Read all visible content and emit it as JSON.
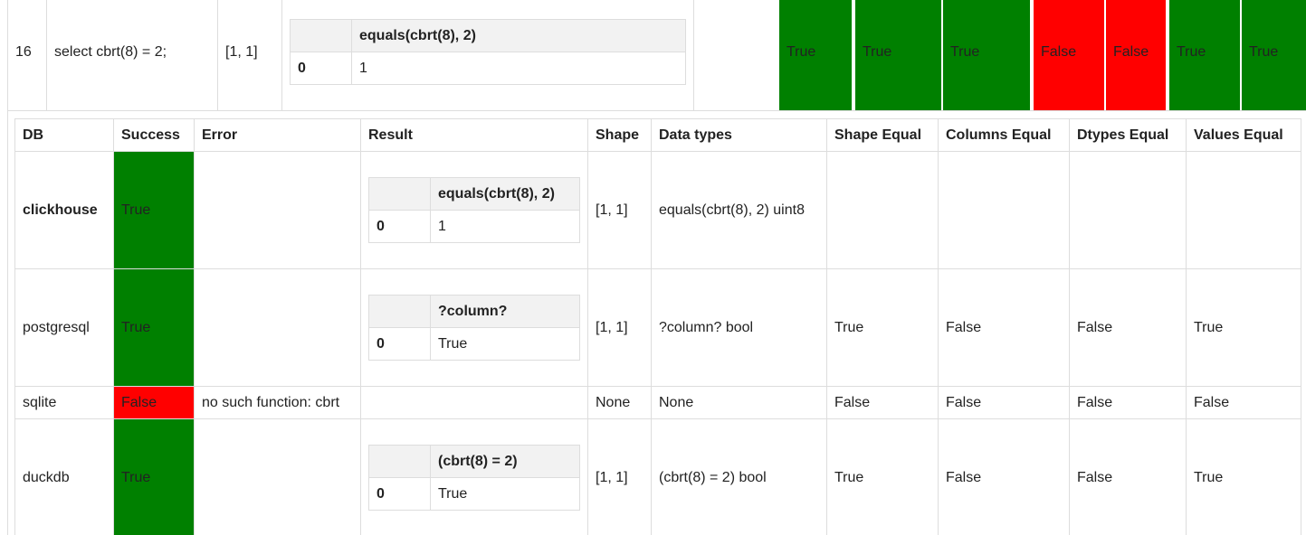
{
  "summary": {
    "row_number": "16",
    "query": "select cbrt(8) = 2;",
    "shape": "[1, 1]",
    "result_table": {
      "column": "equals(cbrt(8), 2)",
      "index": "0",
      "value": "1"
    },
    "flags": [
      {
        "label": "True",
        "status": "green"
      },
      {
        "label": "True",
        "status": "green"
      },
      {
        "label": "True",
        "status": "green"
      },
      {
        "label": "False",
        "status": "red"
      },
      {
        "label": "False",
        "status": "red"
      },
      {
        "label": "True",
        "status": "green"
      },
      {
        "label": "True",
        "status": "green"
      }
    ]
  },
  "comparison": {
    "headers": [
      "DB",
      "Success",
      "Error",
      "Result",
      "Shape",
      "Data types",
      "Shape Equal",
      "Columns Equal",
      "Dtypes Equal",
      "Values Equal"
    ],
    "rows": [
      {
        "db": "clickhouse",
        "success": "True",
        "error": "",
        "result": {
          "column": "equals(cbrt(8), 2)",
          "index": "0",
          "value": "1"
        },
        "shape": "[1, 1]",
        "dtypes": "equals(cbrt(8), 2) uint8",
        "shape_equal": "",
        "columns_equal": "",
        "dtypes_equal": "",
        "values_equal": ""
      },
      {
        "db": "postgresql",
        "success": "True",
        "error": "",
        "result": {
          "column": "?column?",
          "index": "0",
          "value": "True"
        },
        "shape": "[1, 1]",
        "dtypes": "?column? bool",
        "shape_equal": "True",
        "columns_equal": "False",
        "dtypes_equal": "False",
        "values_equal": "True"
      },
      {
        "db": "sqlite",
        "success": "False",
        "error": "no such function: cbrt",
        "result": null,
        "shape": "None",
        "dtypes": "None",
        "shape_equal": "False",
        "columns_equal": "False",
        "dtypes_equal": "False",
        "values_equal": "False"
      },
      {
        "db": "duckdb",
        "success": "True",
        "error": "",
        "result": {
          "column": "(cbrt(8) = 2)",
          "index": "0",
          "value": "True"
        },
        "shape": "[1, 1]",
        "dtypes": "(cbrt(8) = 2) bool",
        "shape_equal": "True",
        "columns_equal": "False",
        "dtypes_equal": "False",
        "values_equal": "True"
      }
    ]
  },
  "colors": {
    "success": "#008000",
    "failure": "#ff0000",
    "border": "#dddddd",
    "header_bg": "#f2f2f2"
  }
}
